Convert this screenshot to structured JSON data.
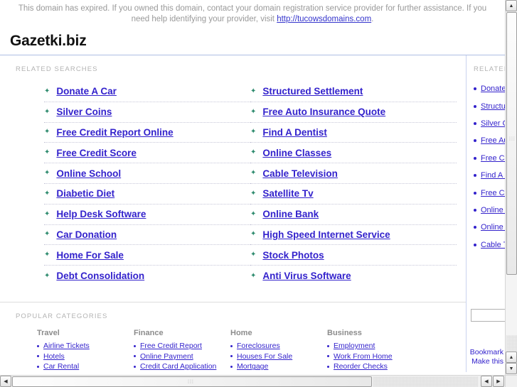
{
  "banner": {
    "text_before": "This domain has expired. If you owned this domain, contact your domain registration service provider for further assistance. If you need help identifying your provider, visit ",
    "link_text": "http://tucowsdomains.com",
    "text_after": "."
  },
  "header": {
    "domain_title": "Gazetki.biz"
  },
  "related_searches": {
    "label": "RELATED SEARCHES",
    "bullet_glyph": "✦",
    "left_column": [
      {
        "label": "Donate A Car"
      },
      {
        "label": "Silver Coins"
      },
      {
        "label": "Free Credit Report Online"
      },
      {
        "label": "Free Credit Score"
      },
      {
        "label": "Online School"
      },
      {
        "label": "Diabetic Diet"
      },
      {
        "label": "Help Desk Software"
      },
      {
        "label": "Car Donation"
      },
      {
        "label": "Home For Sale"
      },
      {
        "label": "Debt Consolidation"
      }
    ],
    "right_column": [
      {
        "label": "Structured Settlement"
      },
      {
        "label": "Free Auto Insurance Quote"
      },
      {
        "label": "Find A Dentist"
      },
      {
        "label": "Online Classes"
      },
      {
        "label": "Cable Television"
      },
      {
        "label": "Satellite Tv"
      },
      {
        "label": "Online Bank"
      },
      {
        "label": "High Speed Internet Service"
      },
      {
        "label": "Stock Photos"
      },
      {
        "label": "Anti Virus Software"
      }
    ]
  },
  "sidebar": {
    "label": "RELATED SEARCHES",
    "items": [
      {
        "label": "Donate A Car"
      },
      {
        "label": "Structured Settlement"
      },
      {
        "label": "Silver Coins"
      },
      {
        "label": "Free Auto Insurance Quote"
      },
      {
        "label": "Free Credit Report Online"
      },
      {
        "label": "Find A Dentist"
      },
      {
        "label": "Free Credit Score"
      },
      {
        "label": "Online Classes"
      },
      {
        "label": "Online School"
      },
      {
        "label": "Cable Television"
      }
    ],
    "search": {
      "value": "",
      "placeholder": ""
    },
    "bookmark_line1": "Bookmark",
    "bookmark_line2": "Make this"
  },
  "popular_categories": {
    "label": "POPULAR CATEGORIES",
    "columns": [
      {
        "heading": "Travel",
        "items": [
          {
            "label": "Airline Tickets"
          },
          {
            "label": "Hotels"
          },
          {
            "label": "Car Rental"
          }
        ]
      },
      {
        "heading": "Finance",
        "items": [
          {
            "label": "Free Credit Report"
          },
          {
            "label": "Online Payment"
          },
          {
            "label": "Credit Card Application"
          }
        ]
      },
      {
        "heading": "Home",
        "items": [
          {
            "label": "Foreclosures"
          },
          {
            "label": "Houses For Sale"
          },
          {
            "label": "Mortgage"
          }
        ]
      },
      {
        "heading": "Business",
        "items": [
          {
            "label": "Employment"
          },
          {
            "label": "Work From Home"
          },
          {
            "label": "Reorder Checks"
          }
        ]
      }
    ]
  },
  "scrollbars": {
    "up_arrow": "▲",
    "down_arrow": "▼",
    "left_arrow": "◀",
    "right_arrow": "▶",
    "grip_glyph": "⁞⁞⁞"
  },
  "colors": {
    "link": "#3322cc",
    "banner_text": "#999999",
    "label": "#b3b3b3",
    "rule": "#aebde4",
    "bullet": "#2e8b6e"
  }
}
